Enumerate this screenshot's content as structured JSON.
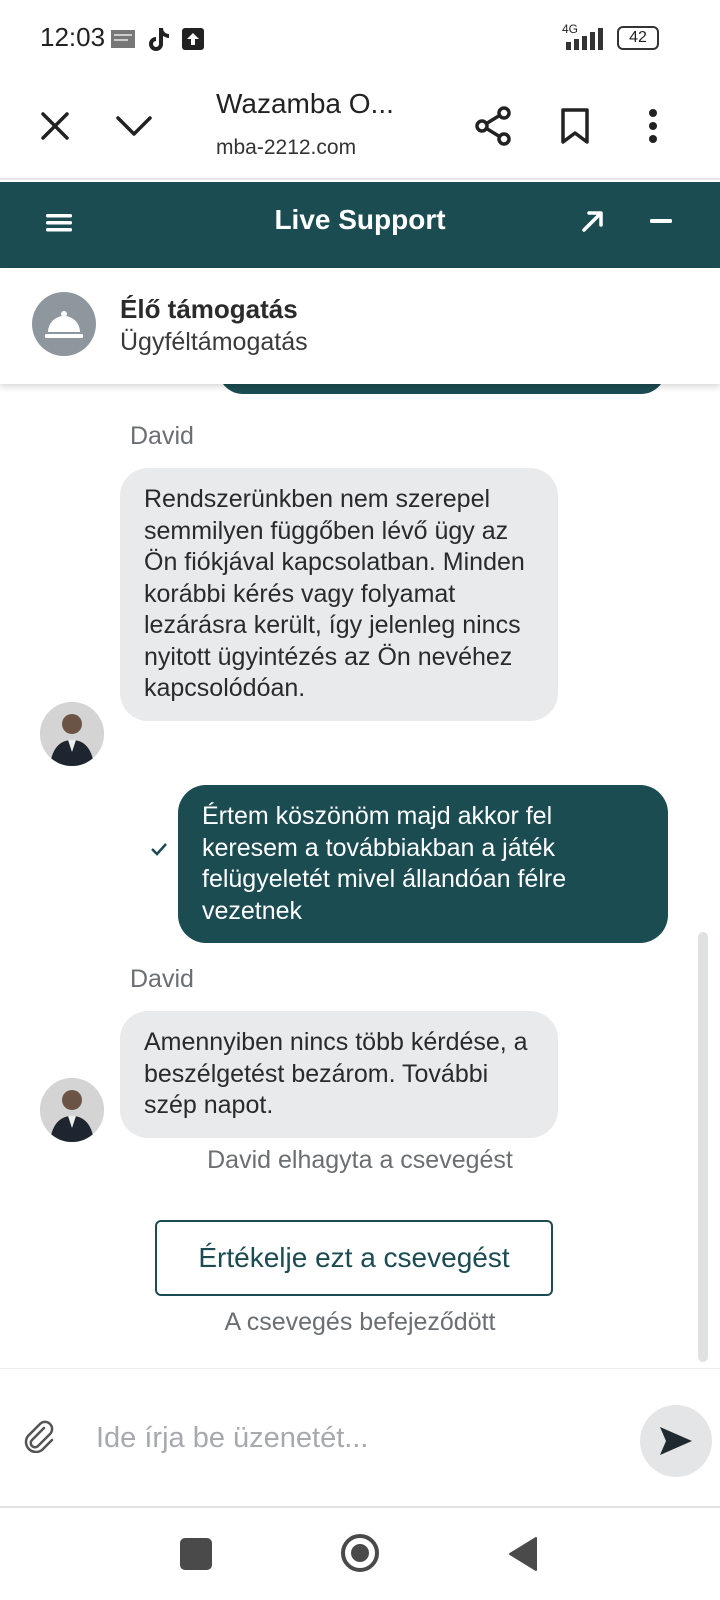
{
  "status_bar": {
    "time": "12:03",
    "network": "4G",
    "battery": "42"
  },
  "browser": {
    "title": "Wazamba O...",
    "url": "mba-2212.com"
  },
  "chat_header": {
    "title": "Live Support"
  },
  "agent_bar": {
    "name": "Élő támogatás",
    "subtitle": "Ügyféltámogatás"
  },
  "messages": [
    {
      "sender": "David",
      "text": "Rendszerünkben nem szerepel semmilyen függőben lévő ügy az Ön fiókjával kapcsolatban. Minden korábbi kérés vagy folyamat lezárásra került, így jelenleg nincs nyitott ügyintézés az Ön nevéhez kapcsolódóan."
    },
    {
      "sender": "",
      "text": "Értem köszönöm majd akkor fel keresem a továbbiakban a játék felügyeletét mivel állandóan félre vezetnek"
    },
    {
      "sender": "David",
      "text": "Amennyiben nincs több kérdése, a beszélgetést bezárom. További szép napot."
    }
  ],
  "system": {
    "left_notice": "David elhagyta a csevegést",
    "rate_button": "Értékelje ezt a csevegést",
    "ended_notice": "A csevegés befejeződött"
  },
  "composer": {
    "placeholder": "Ide írja be üzenetét..."
  },
  "colors": {
    "brand": "#1b4c52",
    "agent_bubble": "#e9eaec"
  }
}
